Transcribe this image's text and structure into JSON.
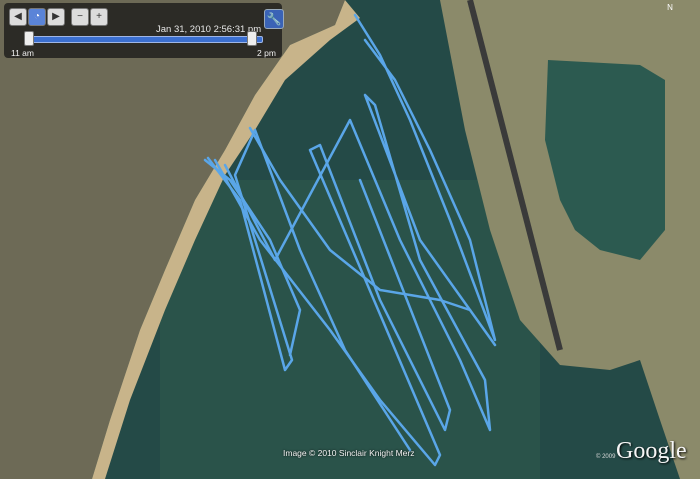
{
  "time_slider": {
    "datetime": "Jan 31, 2010   2:56:31 pm",
    "start_label": "11 am",
    "end_label": "2 pm",
    "position": 0.96
  },
  "map": {
    "credit": "Image © 2010 Sinclair Knight Merz",
    "logo": "Google",
    "year_mark": "© 2009",
    "north_label": "N"
  },
  "track_color": "#5aa6e8",
  "icons": [
    "back-icon",
    "clock-icon",
    "forward-icon",
    "zoom-out-icon",
    "zoom-in-icon",
    "wrench-icon"
  ]
}
